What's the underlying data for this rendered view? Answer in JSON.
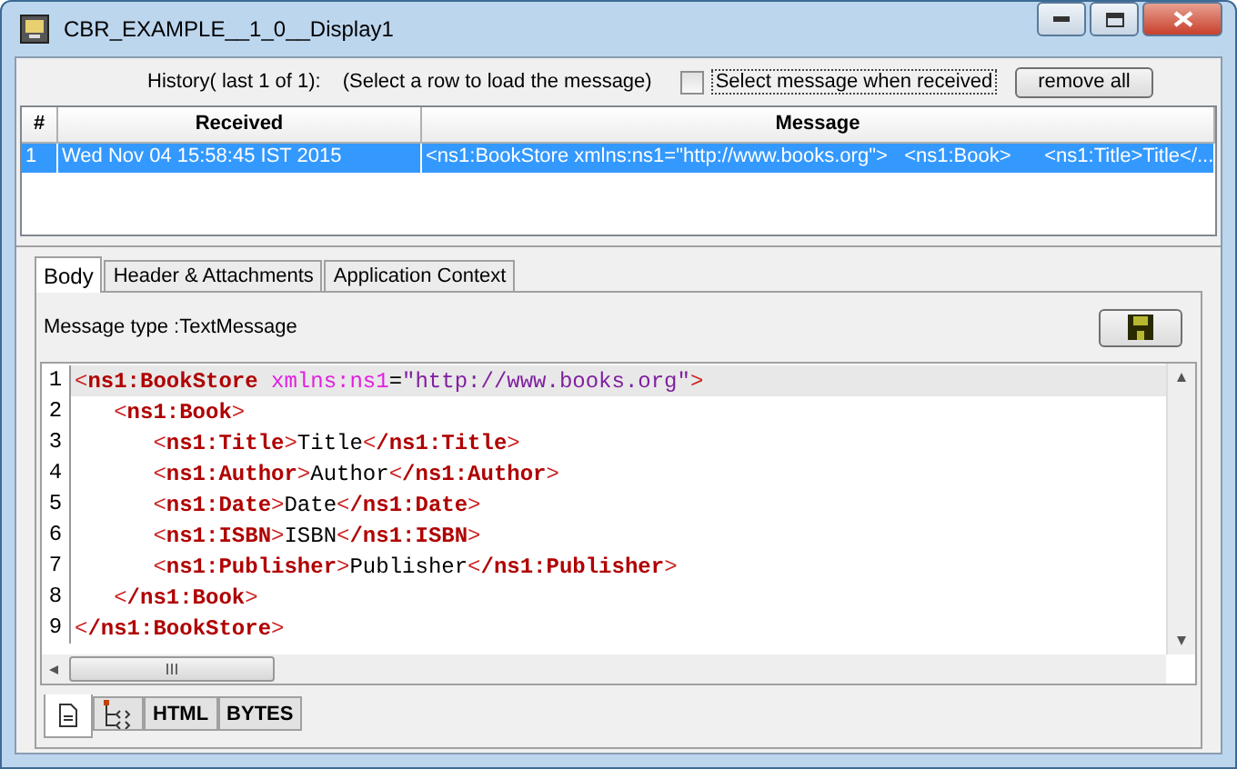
{
  "window": {
    "title": "CBR_EXAMPLE__1_0__Display1"
  },
  "history": {
    "label": "History( last 1 of 1):",
    "hint": "(Select a row to load the message)",
    "auto_select": {
      "label": "Select message when received",
      "checked": false
    },
    "remove_button": "remove all"
  },
  "table": {
    "columns": [
      "#",
      "Received",
      "Message"
    ],
    "rows": [
      {
        "cells": [
          "1",
          "Wed Nov 04 15:58:45 IST 2015",
          "<ns1:BookStore xmlns:ns1=\"http://www.books.org\">   <ns1:Book>      <ns1:Title>Title</..."
        ],
        "selected": true
      }
    ]
  },
  "tabs": [
    {
      "label": "Body",
      "selected": true
    },
    {
      "label": "Header & Attachments",
      "selected": false
    },
    {
      "label": "Application Context",
      "selected": false
    }
  ],
  "message_type": "Message type :TextMessage",
  "editor": {
    "lines": [
      {
        "number": "1",
        "current": true,
        "tokens": [
          {
            "kind": "bracket",
            "text": "<"
          },
          {
            "kind": "name",
            "text": "ns1:BookStore"
          },
          {
            "kind": "attr",
            "text": "xmlns:ns1"
          },
          {
            "kind": "plain",
            "text": "="
          },
          {
            "kind": "value",
            "text": "\"http://www.books.org\""
          },
          {
            "kind": "bracket",
            "text": ">"
          }
        ],
        "children": [
          {
            "number": "2",
            "current": false,
            "tokens": [
              {
                "kind": "bracket",
                "text": "<"
              },
              {
                "kind": "name",
                "text": "ns1:Book"
              },
              {
                "kind": "bracket",
                "text": ">"
              }
            ],
            "children": [
              {
                "number": "3",
                "current": false,
                "tokens": [
                  {
                    "kind": "bracket",
                    "text": "<"
                  },
                  {
                    "kind": "name",
                    "text": "ns1:Title"
                  },
                  {
                    "kind": "bracket",
                    "text": ">"
                  },
                  {
                    "kind": "plain",
                    "text": "Title"
                  },
                  {
                    "kind": "bracket",
                    "text": "<"
                  },
                  {
                    "kind": "name",
                    "text": "/ns1:Title"
                  },
                  {
                    "kind": "bracket",
                    "text": ">"
                  }
                ]
              },
              {
                "number": "4",
                "current": false,
                "tokens": [
                  {
                    "kind": "bracket",
                    "text": "<"
                  },
                  {
                    "kind": "name",
                    "text": "ns1:Author"
                  },
                  {
                    "kind": "bracket",
                    "text": ">"
                  },
                  {
                    "kind": "plain",
                    "text": "Author"
                  },
                  {
                    "kind": "bracket",
                    "text": "<"
                  },
                  {
                    "kind": "name",
                    "text": "/ns1:Author"
                  },
                  {
                    "kind": "bracket",
                    "text": ">"
                  }
                ]
              },
              {
                "number": "5",
                "current": false,
                "tokens": [
                  {
                    "kind": "bracket",
                    "text": "<"
                  },
                  {
                    "kind": "name",
                    "text": "ns1:Date"
                  },
                  {
                    "kind": "bracket",
                    "text": ">"
                  },
                  {
                    "kind": "plain",
                    "text": "Date"
                  },
                  {
                    "kind": "bracket",
                    "text": "<"
                  },
                  {
                    "kind": "name",
                    "text": "/ns1:Date"
                  },
                  {
                    "kind": "bracket",
                    "text": ">"
                  }
                ]
              },
              {
                "number": "6",
                "current": false,
                "tokens": [
                  {
                    "kind": "bracket",
                    "text": "<"
                  },
                  {
                    "kind": "name",
                    "text": "ns1:ISBN"
                  },
                  {
                    "kind": "bracket",
                    "text": ">"
                  },
                  {
                    "kind": "plain",
                    "text": "ISBN"
                  },
                  {
                    "kind": "bracket",
                    "text": "<"
                  },
                  {
                    "kind": "name",
                    "text": "/ns1:ISBN"
                  },
                  {
                    "kind": "bracket",
                    "text": ">"
                  }
                ]
              },
              {
                "number": "7",
                "current": false,
                "tokens": [
                  {
                    "kind": "bracket",
                    "text": "<"
                  },
                  {
                    "kind": "name",
                    "text": "ns1:Publisher"
                  },
                  {
                    "kind": "bracket",
                    "text": ">"
                  },
                  {
                    "kind": "plain",
                    "text": "Publisher"
                  },
                  {
                    "kind": "bracket",
                    "text": "<"
                  },
                  {
                    "kind": "name",
                    "text": "/ns1:Publisher"
                  },
                  {
                    "kind": "bracket",
                    "text": ">"
                  }
                ]
              }
            ]
          },
          {
            "number": "8",
            "current": false,
            "tokens": [
              {
                "kind": "bracket",
                "text": "<"
              },
              {
                "kind": "name",
                "text": "/ns1:Book"
              },
              {
                "kind": "bracket",
                "text": ">"
              }
            ]
          }
        ]
      },
      {
        "number": "9",
        "current": false,
        "tokens": [
          {
            "kind": "bracket",
            "text": "<"
          },
          {
            "kind": "name",
            "text": "/ns1:BookStore"
          },
          {
            "kind": "bracket",
            "text": ">"
          }
        ]
      }
    ]
  },
  "view_tabs": [
    {
      "kind": "document",
      "selected": true
    },
    {
      "kind": "tree",
      "selected": false
    },
    {
      "kind": "text",
      "label": "HTML",
      "selected": false
    },
    {
      "kind": "text",
      "label": "BYTES",
      "selected": false
    }
  ]
}
